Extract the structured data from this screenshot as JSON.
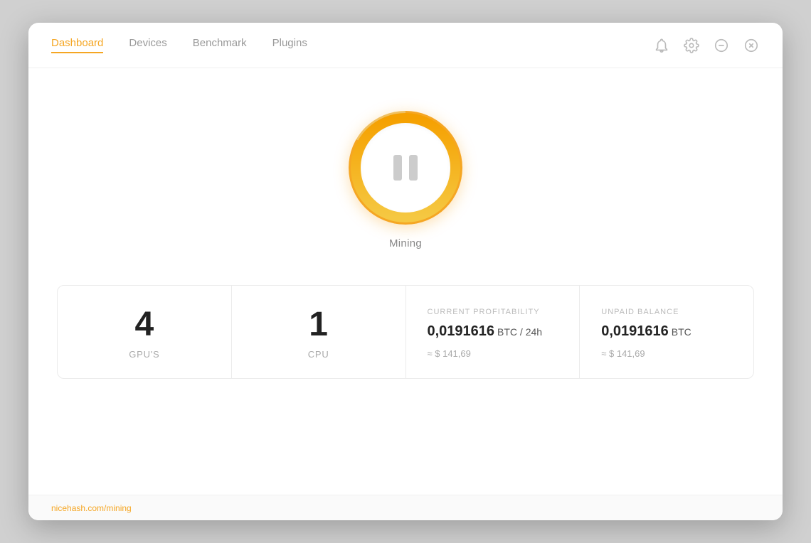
{
  "nav": {
    "tabs": [
      {
        "id": "dashboard",
        "label": "Dashboard",
        "active": true
      },
      {
        "id": "devices",
        "label": "Devices",
        "active": false
      },
      {
        "id": "benchmark",
        "label": "Benchmark",
        "active": false
      },
      {
        "id": "plugins",
        "label": "Plugins",
        "active": false
      }
    ]
  },
  "window_controls": {
    "notification_label": "notifications",
    "settings_label": "settings",
    "minimize_label": "minimize",
    "close_label": "close"
  },
  "mining": {
    "status_label": "Mining",
    "button_state": "paused"
  },
  "stats": [
    {
      "id": "gpus",
      "value": "4",
      "label": "GPU'S",
      "type": "count"
    },
    {
      "id": "cpu",
      "value": "1",
      "label": "CPU",
      "type": "count"
    },
    {
      "id": "profitability",
      "title": "CURRENT PROFITABILITY",
      "main_value": "0,0191616",
      "unit": "BTC / 24h",
      "sub_value": "≈ $ 141,69",
      "type": "info"
    },
    {
      "id": "balance",
      "title": "UNPAID BALANCE",
      "main_value": "0,0191616",
      "unit": "BTC",
      "sub_value": "≈ $ 141,69",
      "type": "info"
    }
  ],
  "bottom": {
    "link_text": "nicehash.com/mining"
  },
  "colors": {
    "accent": "#f5a623",
    "text_dark": "#222222",
    "text_light": "#aaaaaa",
    "border": "#ebebeb"
  }
}
